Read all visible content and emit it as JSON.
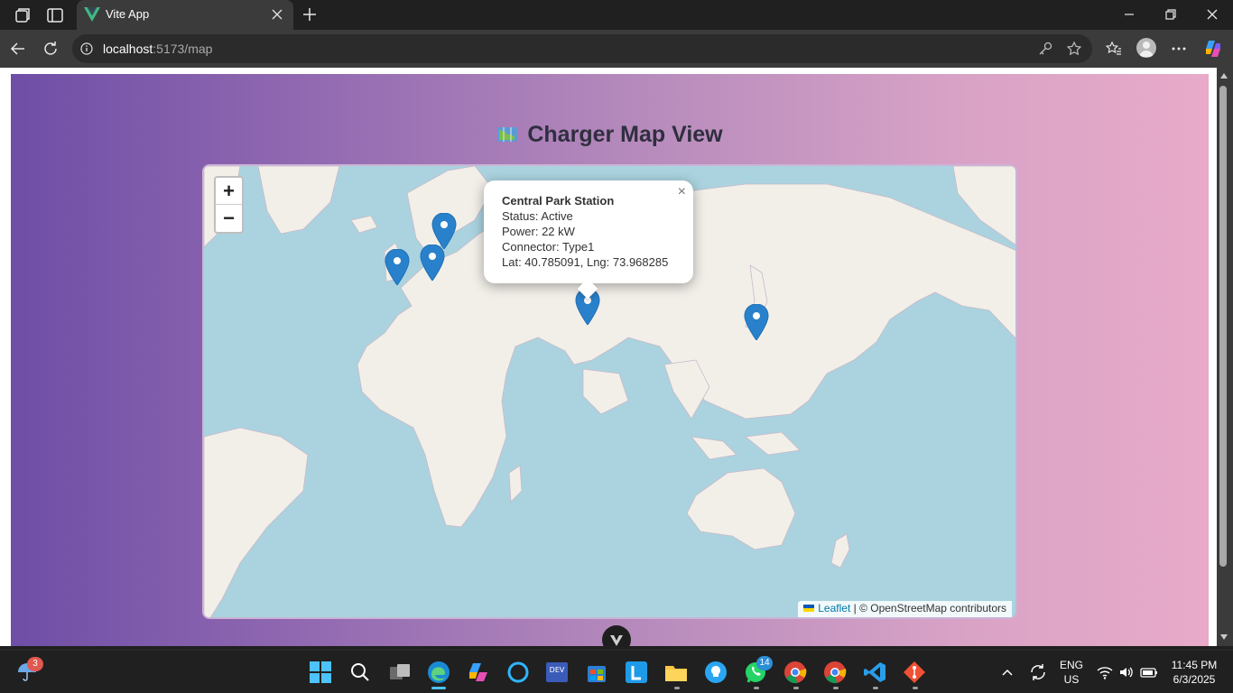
{
  "browser": {
    "tab_title": "Vite App",
    "url_host": "localhost",
    "url_path": ":5173/map"
  },
  "page": {
    "title": "Charger Map View",
    "title_icon": "world-map-emoji"
  },
  "map": {
    "zoom_in_label": "+",
    "zoom_out_label": "−",
    "popup": {
      "title": "Central Park Station",
      "status": "Status: Active",
      "power": "Power: 22 kW",
      "connector": "Connector: Type1",
      "coords": "Lat: 40.785091, Lng: 73.968285",
      "close_label": "×"
    },
    "attribution": {
      "leaflet": "Leaflet",
      "separator": " | ",
      "rest": "© OpenStreetMap contributors"
    },
    "marker_color": "#2a81cb"
  },
  "taskbar": {
    "weather_badge": "3",
    "whatsapp_badge": "14",
    "language_line1": "ENG",
    "language_line2": "US",
    "time": "11:45 PM",
    "date": "6/3/2025"
  },
  "colors": {
    "gradient_start": "#6e4fa6",
    "gradient_end": "#e8aac8",
    "accent": "#4cc2ff"
  }
}
